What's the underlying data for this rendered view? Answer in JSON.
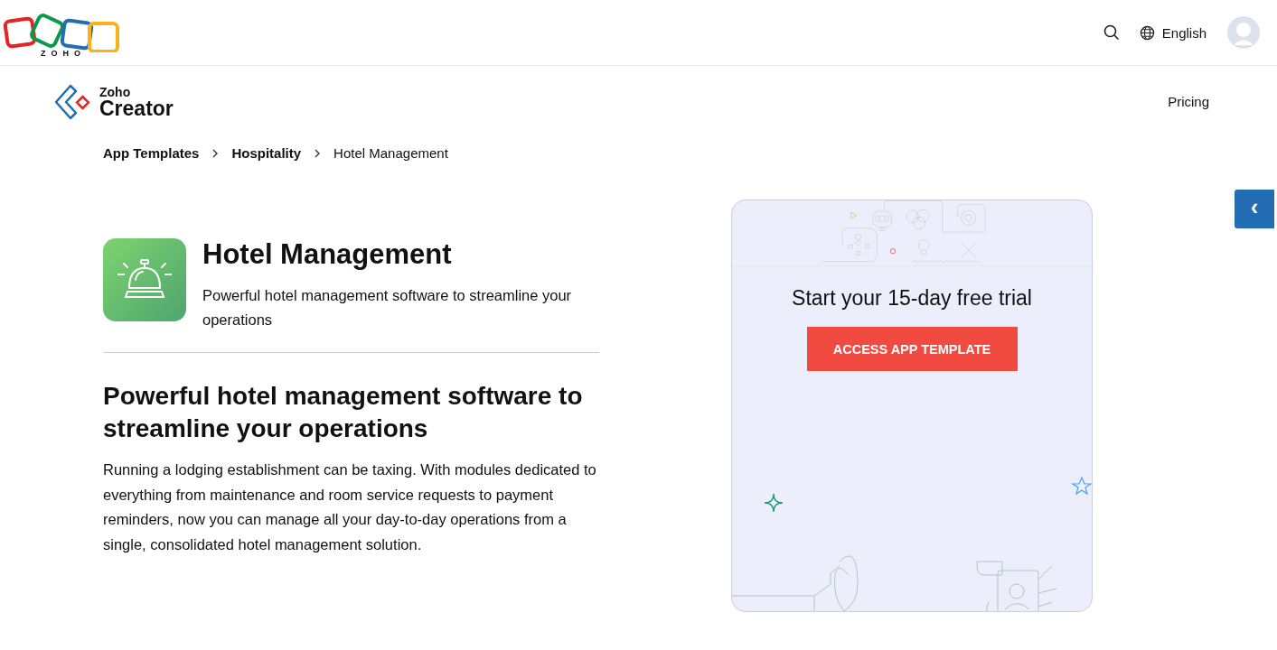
{
  "header": {
    "brand_wordmark": "ZOHO",
    "language": "English"
  },
  "nav": {
    "product_prefix": "Zoho",
    "product_name": "Creator",
    "links": [
      "Pricing"
    ]
  },
  "breadcrumb": [
    {
      "label": "App Templates",
      "current": false
    },
    {
      "label": "Hospitality",
      "current": false
    },
    {
      "label": "Hotel Management",
      "current": true
    }
  ],
  "app": {
    "title": "Hotel Management",
    "subtitle": "Powerful hotel management software to streamline your operations"
  },
  "section": {
    "heading": "Powerful hotel management software to streamline your operations",
    "body": "Running a lodging establishment can be taxing. With modules dedicated to everything from maintenance and room service requests to payment reminders, now you can manage all your day-to-day operations from a single, consolidated hotel management solution."
  },
  "trial_card": {
    "heading": "Start your 15-day free trial",
    "button": "ACCESS APP TEMPLATE"
  },
  "side_tab": {
    "glyph": "‹"
  }
}
